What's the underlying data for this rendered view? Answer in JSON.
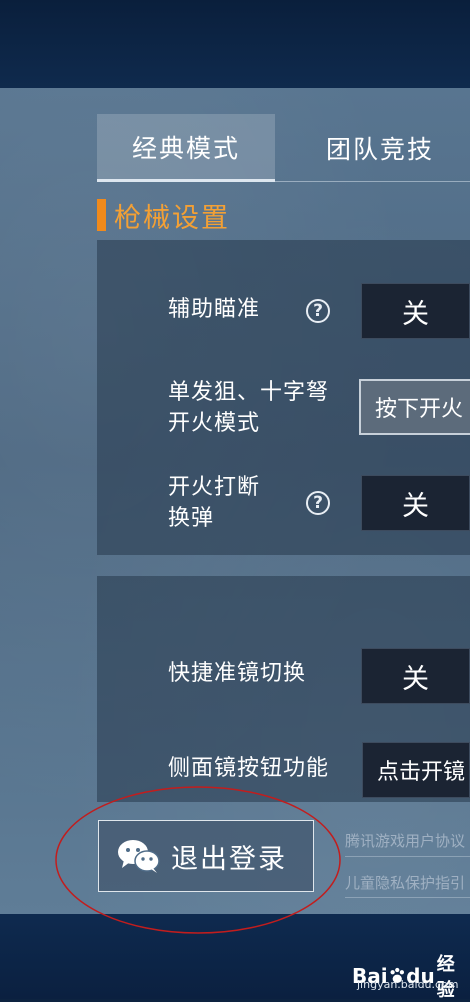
{
  "tabs": [
    {
      "label": "经典模式",
      "active": true
    },
    {
      "label": "团队竞技",
      "active": false
    }
  ],
  "section": {
    "title": "枪械设置"
  },
  "settings_group1": [
    {
      "label_lines": [
        "辅助瞄准"
      ],
      "help": "?",
      "value": "关"
    },
    {
      "label_lines": [
        "单发狙、十字弩",
        "开火模式"
      ],
      "value": "按下开火"
    },
    {
      "label_lines": [
        "开火打断",
        "换弹"
      ],
      "help": "?",
      "value": "关"
    }
  ],
  "settings_group2": [
    {
      "label_lines": [
        "快捷准镜切换"
      ],
      "value": "关"
    },
    {
      "label_lines": [
        "侧面镜按钮功能"
      ],
      "value": "点击开镜"
    }
  ],
  "logout": {
    "label": "退出登录",
    "icon": "wechat-icon"
  },
  "links": [
    "腾讯游戏用户协议",
    "儿童隐私保护指引"
  ],
  "watermark": {
    "brand_bai": "Bai",
    "brand_du": "du",
    "brand_jingyan": "经验",
    "sub": "jingyan.baidu.com"
  },
  "colors": {
    "accent": "#f08a1c",
    "annotation": "#c21d1d"
  }
}
